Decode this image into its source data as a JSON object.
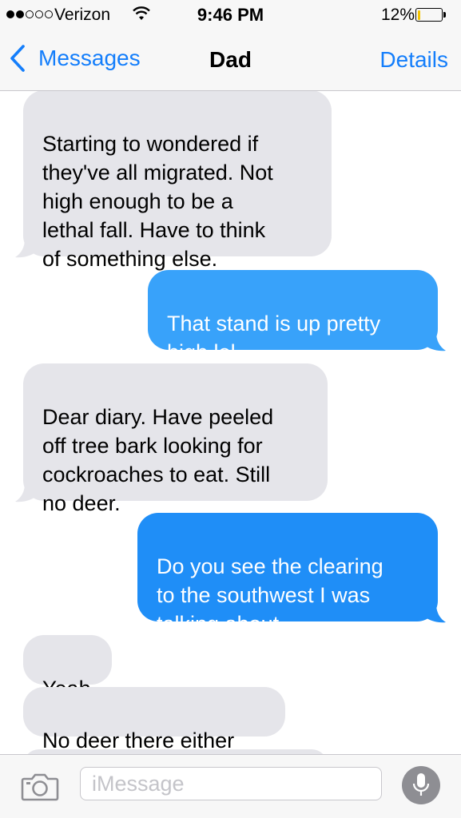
{
  "status_bar": {
    "carrier": "Verizon",
    "time": "9:46 PM",
    "battery_percent": "12%",
    "battery_level": 0.12,
    "signal_bars_filled": 2,
    "signal_bars_total": 5
  },
  "nav": {
    "back_label": "Messages",
    "title": "Dad",
    "details_label": "Details"
  },
  "messages": [
    {
      "from": "them",
      "text": "Starting to wondered if\nthey've all migrated. Not\nhigh enough to be a\nlethal fall. Have to think\nof something else."
    },
    {
      "from": "me",
      "text": "That stand is up pretty\nhigh lol"
    },
    {
      "from": "them",
      "text": "Dear diary. Have peeled\noff tree bark looking for\ncockroaches to eat. Still\nno deer."
    },
    {
      "from": "me",
      "text": "Do you see the clearing\nto the southwest I was\ntalking about"
    },
    {
      "from": "them",
      "text": "Yeah"
    },
    {
      "from": "them",
      "text": "No deer there either"
    }
  ],
  "input_bar": {
    "placeholder": "iMessage",
    "value": ""
  },
  "icons": {
    "back": "chevron-left-icon",
    "wifi": "wifi-icon",
    "battery": "battery-icon",
    "camera": "camera-icon",
    "microphone": "microphone-icon"
  },
  "colors": {
    "accent": "#147efb",
    "incoming_bubble": "#e5e5ea",
    "outgoing_bubble": "#1f8ef7",
    "battery_fill": "#f5c400"
  }
}
